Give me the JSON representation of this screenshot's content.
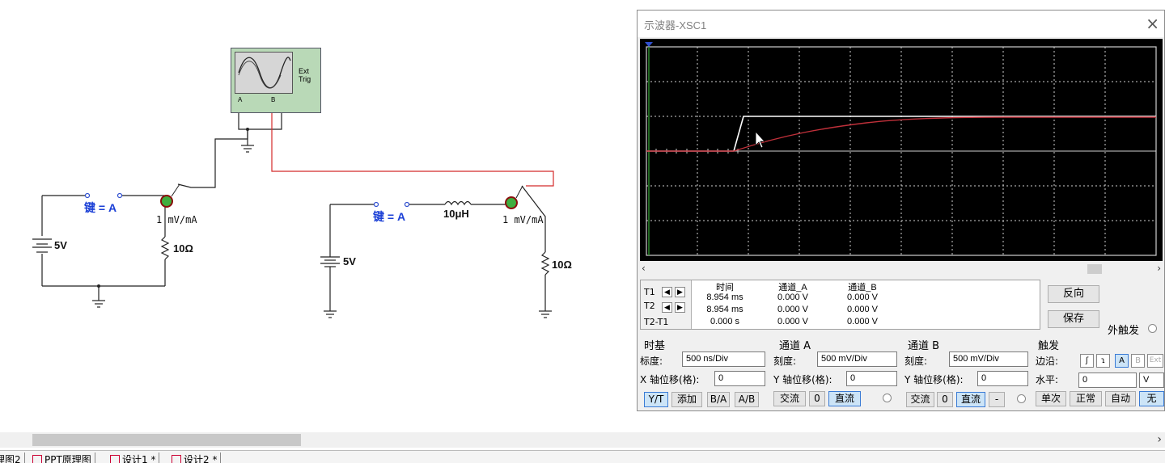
{
  "schematic": {
    "circuit1": {
      "switch_label": "键 = A",
      "source_label": "5V",
      "resistor_label": "10Ω",
      "probe_label": "1  mV/mA"
    },
    "circuit2": {
      "switch_label": "键 = A",
      "source_label": "5V",
      "inductor_label": "10μH",
      "resistor_label": "10Ω",
      "probe_label": "1  mV/mA"
    },
    "scope_icon": {
      "ext_trig_label": "Ext Trig",
      "a_label": "A",
      "b_label": "B"
    }
  },
  "scope_window": {
    "title": "示波器-XSC1",
    "readout": {
      "headers": [
        "时间",
        "通道_A",
        "通道_B"
      ],
      "rows": [
        {
          "label": "T1",
          "time": "8.954 ms",
          "ch_a": "0.000 V",
          "ch_b": "0.000 V"
        },
        {
          "label": "T2",
          "time": "8.954 ms",
          "ch_a": "0.000 V",
          "ch_b": "0.000 V"
        },
        {
          "label": "T2-T1",
          "time": "0.000 s",
          "ch_a": "0.000 V",
          "ch_b": "0.000 V"
        }
      ]
    },
    "reverse_button": "反向",
    "save_button": "保存",
    "ext_trigger_label": "外触发",
    "timebase": {
      "title": "时基",
      "scale_label": "标度:",
      "scale_value": "500 ns/Div",
      "xpos_label": "X 轴位移(格):",
      "xpos_value": "0",
      "modes": [
        "Y/T",
        "添加",
        "B/A",
        "A/B"
      ]
    },
    "channel_a": {
      "title": "通道 A",
      "scale_label": "刻度:",
      "scale_value": "500 mV/Div",
      "ypos_label": "Y 轴位移(格):",
      "ypos_value": "0",
      "coupling": [
        "交流",
        "0",
        "直流"
      ]
    },
    "channel_b": {
      "title": "通道 B",
      "scale_label": "刻度:",
      "scale_value": "500 mV/Div",
      "ypos_label": "Y 轴位移(格):",
      "ypos_value": "0",
      "coupling": [
        "交流",
        "0",
        "直流",
        "-"
      ]
    },
    "trigger": {
      "title": "触发",
      "edge_label": "边沿:",
      "level_label": "水平:",
      "level_value": "0",
      "level_unit": "V",
      "edge_buttons": [
        "A",
        "B",
        "Ext"
      ],
      "modes": [
        "单次",
        "正常",
        "自动",
        "无"
      ]
    },
    "colors": {
      "plot_bg": "#000000",
      "grid": "#cfcfcf",
      "trace_a": "#ffffff",
      "trace_b": "#c0303a",
      "wire_b": "#d42a2a"
    }
  },
  "tabs": [
    "理图2",
    "PPT原理图",
    "设计1 *",
    "设计2 *"
  ]
}
